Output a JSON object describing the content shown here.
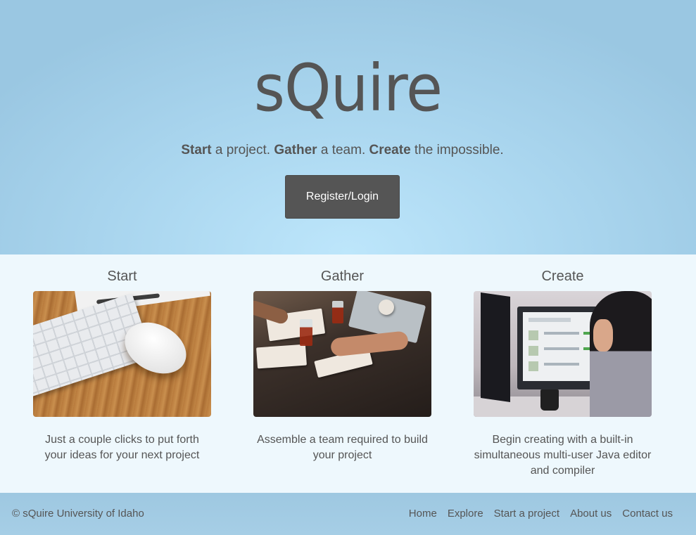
{
  "hero": {
    "logo": "sQuire",
    "tagline": [
      {
        "bold": "Start",
        "rest": " a project. "
      },
      {
        "bold": "Gather",
        "rest": " a team. "
      },
      {
        "bold": "Create",
        "rest": " the impossible."
      }
    ],
    "register_button": "Register/Login"
  },
  "features": [
    {
      "title": "Start",
      "description": "Just a couple clicks to put forth your ideas for your next project"
    },
    {
      "title": "Gather",
      "description": "Assemble a team required to build your project"
    },
    {
      "title": "Create",
      "description": "Begin creating with a built-in simultaneous multi-user Java editor and compiler"
    }
  ],
  "footer": {
    "copyright": "© sQuire University of Idaho",
    "nav": [
      "Home",
      "Explore",
      "Start a project",
      "About us",
      "Contact us"
    ]
  },
  "colors": {
    "hero_background": "#a9d5ee",
    "button_background": "#555555",
    "features_background": "#eef8fd",
    "footer_background": "#a0cae3",
    "text": "#555555"
  }
}
